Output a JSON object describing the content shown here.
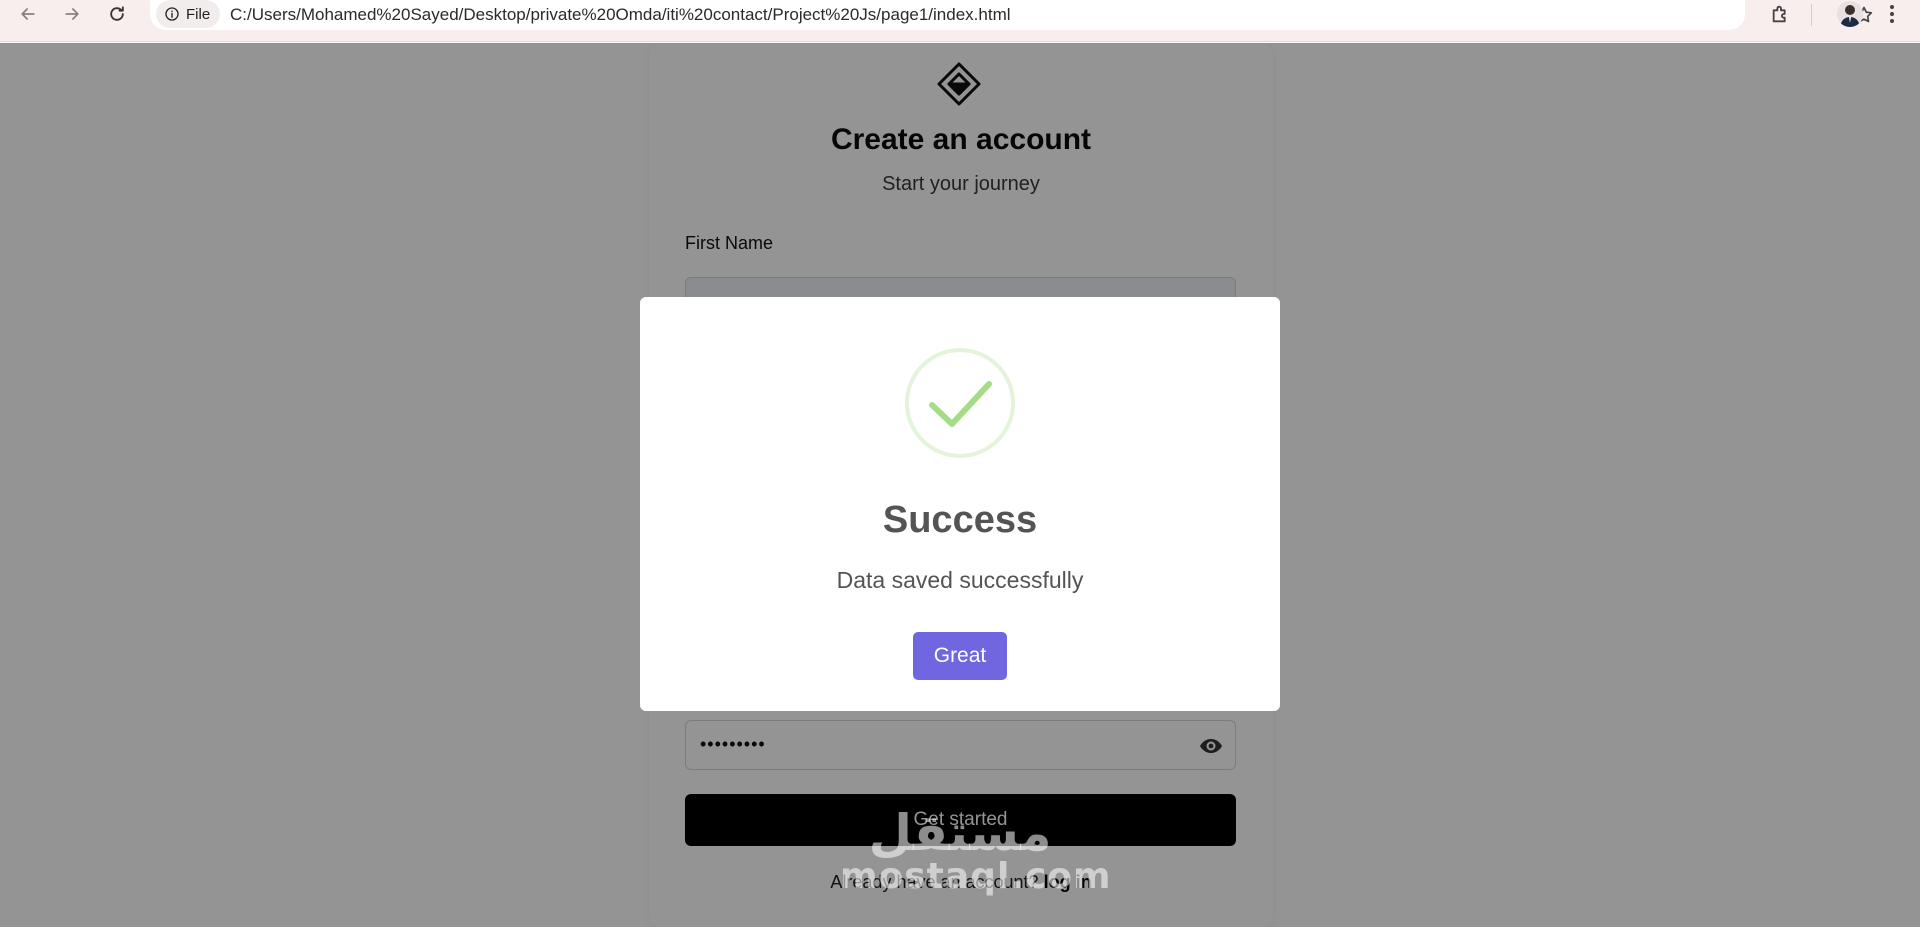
{
  "browser": {
    "site_chip_label": "File",
    "url": "C:/Users/Mohamed%20Sayed/Desktop/private%20Omda/iti%20contact/Project%20Js/page1/index.html"
  },
  "form": {
    "title": "Create an account",
    "subtitle": "Start your journey",
    "first_name_label": "First Name",
    "password_value": "•••••••••",
    "submit_label": "Get started",
    "login_prompt": "Already have an account?",
    "login_link": "log in"
  },
  "modal": {
    "title": "Success",
    "text": "Data saved successfully",
    "confirm_label": "Great",
    "colors": {
      "confirm": "#7066e0",
      "success_icon": "#a5dc86"
    }
  },
  "watermark": {
    "arabic": "مستقل",
    "latin": "mostaql.com"
  }
}
